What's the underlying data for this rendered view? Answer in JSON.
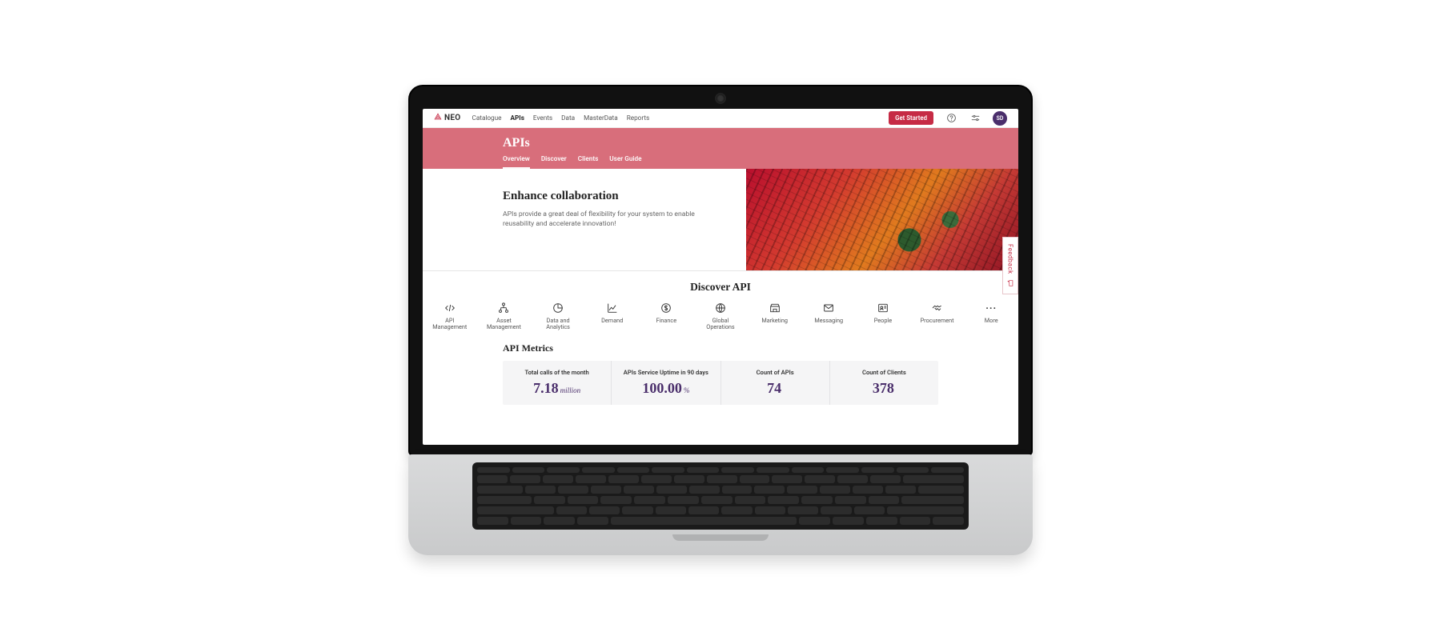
{
  "brand": {
    "name": "NEO"
  },
  "nav": {
    "items": [
      {
        "label": "Catalogue",
        "active": false
      },
      {
        "label": "APIs",
        "active": true
      },
      {
        "label": "Events",
        "active": false
      },
      {
        "label": "Data",
        "active": false
      },
      {
        "label": "MasterData",
        "active": false
      },
      {
        "label": "Reports",
        "active": false
      }
    ],
    "cta": "Get Started",
    "avatar_initials": "SD"
  },
  "header": {
    "title": "APIs",
    "tabs": [
      {
        "label": "Overview",
        "active": true
      },
      {
        "label": "Discover",
        "active": false
      },
      {
        "label": "Clients",
        "active": false
      },
      {
        "label": "User Guide",
        "active": false
      }
    ]
  },
  "hero": {
    "heading": "Enhance collaboration",
    "body": "APIs provide a great deal of flexibility for your system to enable reusability and accelerate innovation!"
  },
  "feedback_label": "Feedback",
  "discover": {
    "heading": "Discover API",
    "categories": [
      {
        "label": "API Management",
        "icon": "code-icon"
      },
      {
        "label": "Asset Management",
        "icon": "hierarchy-icon"
      },
      {
        "label": "Data and Analytics",
        "icon": "pie-icon"
      },
      {
        "label": "Demand",
        "icon": "trend-icon"
      },
      {
        "label": "Finance",
        "icon": "dollar-icon"
      },
      {
        "label": "Global Operations",
        "icon": "globe-icon"
      },
      {
        "label": "Marketing",
        "icon": "storefront-icon"
      },
      {
        "label": "Messaging",
        "icon": "envelope-icon"
      },
      {
        "label": "People",
        "icon": "person-card-icon"
      },
      {
        "label": "Procurement",
        "icon": "handshake-icon"
      },
      {
        "label": "More",
        "icon": "more-icon"
      }
    ]
  },
  "metrics": {
    "heading": "API Metrics",
    "items": [
      {
        "label": "Total calls of the month",
        "value": "7.18",
        "unit": "million"
      },
      {
        "label": "APIs Service Uptime in 90 days",
        "value": "100.00",
        "unit": "%"
      },
      {
        "label": "Count of APIs",
        "value": "74",
        "unit": ""
      },
      {
        "label": "Count of Clients",
        "value": "378",
        "unit": ""
      }
    ]
  },
  "colors": {
    "accent": "#c62b45",
    "band": "#d86e7b",
    "metric_value": "#4a2e6b"
  }
}
